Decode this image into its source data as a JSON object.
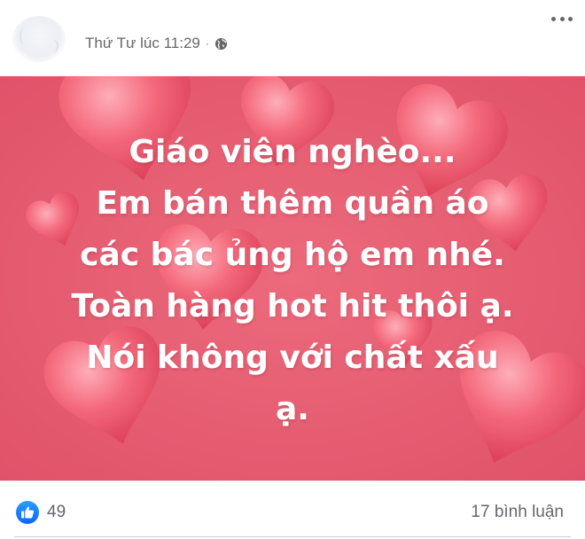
{
  "header": {
    "timestamp": "Thứ Tư lúc 11:29",
    "separator": "·",
    "privacy_icon": "globe-icon",
    "more_icon": "more-horizontal-icon"
  },
  "post": {
    "background_color": "#e6586e",
    "text_lines": [
      "Giáo viên nghèo...",
      "Em bán thêm quần áo",
      "các bác ủng hộ em nhé.",
      "Toàn hàng hot hit thôi ạ.",
      "Nói không với chất xấu",
      "ạ."
    ]
  },
  "footer": {
    "like_icon": "like-icon",
    "like_count": "49",
    "comment_count_label": "17 bình luận"
  }
}
